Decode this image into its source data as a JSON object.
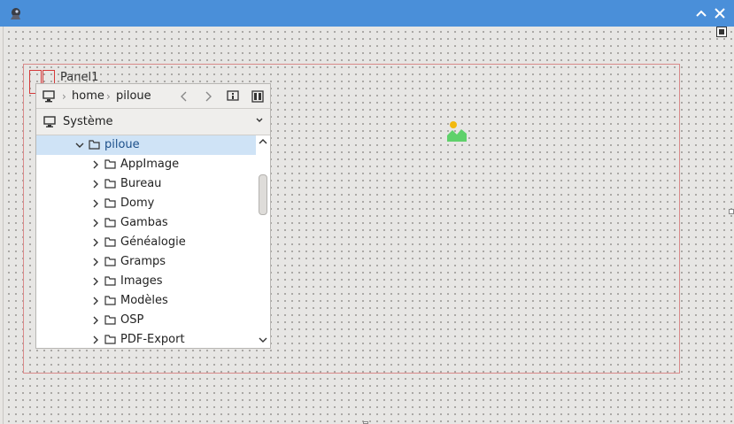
{
  "panel": {
    "label": "Panel1"
  },
  "breadcrumb": {
    "items": [
      "home",
      "piloue"
    ]
  },
  "device": {
    "label": "Système"
  },
  "tree": {
    "current": "piloue",
    "children": [
      "AppImage",
      "Bureau",
      "Domy",
      "Gambas",
      "Généalogie",
      "Gramps",
      "Images",
      "Modèles",
      "OSP",
      "PDF-Export"
    ]
  },
  "colors": {
    "titlebar": "#4a8fd9",
    "selection": "#cfe3f6",
    "panel_border": "#d98a8a",
    "red_markers": "#d43a3a"
  },
  "icons": {
    "app": "gambas-icon",
    "maximize": "chevron-up-icon",
    "close": "close-icon",
    "image": "image-icon",
    "computer": "computer-icon",
    "folder": "folder-icon",
    "details": "info-icon",
    "view": "view-columns-icon"
  }
}
